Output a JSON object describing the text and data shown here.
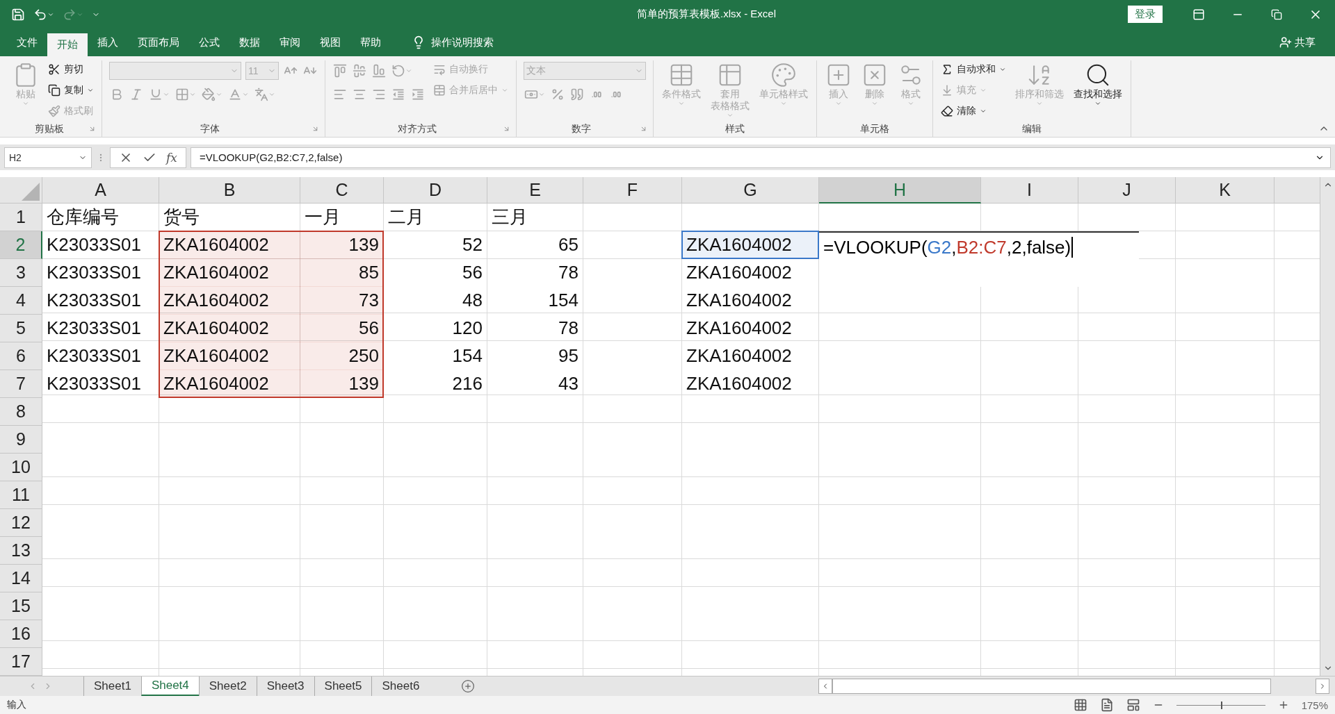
{
  "window": {
    "title": "简单的预算表模板.xlsx  -  Excel",
    "sign_in": "登录"
  },
  "menu_tabs": [
    {
      "label": "文件",
      "selected": false
    },
    {
      "label": "开始",
      "selected": true
    },
    {
      "label": "插入",
      "selected": false
    },
    {
      "label": "页面布局",
      "selected": false
    },
    {
      "label": "公式",
      "selected": false
    },
    {
      "label": "数据",
      "selected": false
    },
    {
      "label": "审阅",
      "selected": false
    },
    {
      "label": "视图",
      "selected": false
    },
    {
      "label": "帮助",
      "selected": false
    }
  ],
  "tell_me": "操作说明搜索",
  "share": "共享",
  "ribbon": [
    {
      "label": "剪贴板",
      "launcher": true,
      "controls": [
        {
          "kind": "large",
          "label": "粘贴",
          "disabled": true,
          "dropdown": true
        },
        {
          "kind": "column",
          "children": [
            {
              "kind": "small",
              "label": "剪切",
              "disabled": false,
              "dropdown": false
            },
            {
              "kind": "small",
              "label": "复制",
              "disabled": false,
              "dropdown": true
            },
            {
              "kind": "small",
              "label": "格式刷",
              "disabled": true,
              "dropdown": false
            }
          ]
        }
      ]
    },
    {
      "label": "字体",
      "launcher": true,
      "controls": [
        {
          "kind": "column",
          "children": [
            {
              "kind": "row",
              "children": [
                {
                  "kind": "combo",
                  "disabled": true
                },
                {
                  "kind": "combo",
                  "value": "11",
                  "disabled": true
                },
                {
                  "kind": "icon",
                  "disabled": true,
                  "dropdown": false
                },
                {
                  "kind": "icon",
                  "disabled": true,
                  "dropdown": false
                }
              ]
            },
            {
              "kind": "row",
              "children": [
                {
                  "kind": "icon",
                  "disabled": true,
                  "dropdown": false
                },
                {
                  "kind": "icon",
                  "disabled": true,
                  "dropdown": false
                },
                {
                  "kind": "icon",
                  "disabled": true,
                  "dropdown": true
                },
                {
                  "kind": "icon",
                  "disabled": true,
                  "dropdown": true
                },
                {
                  "kind": "icon",
                  "disabled": true,
                  "dropdown": true
                },
                {
                  "kind": "icon",
                  "disabled": true,
                  "dropdown": true
                },
                {
                  "kind": "icon",
                  "disabled": true,
                  "dropdown": true
                }
              ]
            }
          ]
        }
      ]
    },
    {
      "label": "对齐方式",
      "launcher": true,
      "controls": [
        {
          "kind": "column",
          "children": [
            {
              "kind": "row",
              "children": [
                {
                  "kind": "icon",
                  "disabled": true,
                  "dropdown": false
                },
                {
                  "kind": "icon",
                  "disabled": true,
                  "dropdown": false
                },
                {
                  "kind": "icon",
                  "disabled": true,
                  "dropdown": false
                },
                {
                  "kind": "icon",
                  "disabled": true,
                  "dropdown": true
                }
              ]
            },
            {
              "kind": "row",
              "children": [
                {
                  "kind": "icon",
                  "disabled": true,
                  "dropdown": false
                },
                {
                  "kind": "icon",
                  "disabled": true,
                  "dropdown": false
                },
                {
                  "kind": "icon",
                  "disabled": true,
                  "dropdown": false
                },
                {
                  "kind": "icon",
                  "disabled": true,
                  "dropdown": false
                },
                {
                  "kind": "icon",
                  "disabled": true,
                  "dropdown": false
                }
              ]
            }
          ]
        },
        {
          "kind": "column",
          "children": [
            {
              "kind": "small",
              "label": "自动换行",
              "disabled": true,
              "dropdown": false
            },
            {
              "kind": "small",
              "label": "合并后居中",
              "disabled": true,
              "dropdown": true
            }
          ]
        }
      ]
    },
    {
      "label": "数字",
      "launcher": true,
      "controls": [
        {
          "kind": "column",
          "children": [
            {
              "kind": "combo",
              "value": "文本",
              "disabled": true
            },
            {
              "kind": "row",
              "children": [
                {
                  "kind": "icon",
                  "disabled": true,
                  "dropdown": true
                },
                {
                  "kind": "icon",
                  "disabled": true,
                  "dropdown": false
                },
                {
                  "kind": "icon",
                  "disabled": true,
                  "dropdown": false
                },
                {
                  "kind": "icon",
                  "disabled": true,
                  "dropdown": false
                },
                {
                  "kind": "icon",
                  "disabled": true,
                  "dropdown": false
                }
              ]
            }
          ]
        }
      ]
    },
    {
      "label": "样式",
      "launcher": false,
      "controls": [
        {
          "kind": "large",
          "label": "条件格式",
          "disabled": true,
          "dropdown": true
        },
        {
          "kind": "large",
          "lines": [
            "套用",
            "表格格式"
          ],
          "disabled": true,
          "dropdown": true
        },
        {
          "kind": "large",
          "label": "单元格样式",
          "disabled": true,
          "dropdown": true
        }
      ]
    },
    {
      "label": "单元格",
      "launcher": false,
      "controls": [
        {
          "kind": "large",
          "label": "插入",
          "disabled": true,
          "dropdown": true
        },
        {
          "kind": "large",
          "label": "删除",
          "disabled": true,
          "dropdown": true
        },
        {
          "kind": "large",
          "label": "格式",
          "disabled": true,
          "dropdown": true
        }
      ]
    },
    {
      "label": "编辑",
      "launcher": false,
      "controls": [
        {
          "kind": "column",
          "children": [
            {
              "kind": "small",
              "label": "自动求和",
              "disabled": false,
              "dropdown": true
            },
            {
              "kind": "small",
              "label": "填充",
              "disabled": true,
              "dropdown": true
            },
            {
              "kind": "small",
              "label": "清除",
              "disabled": false,
              "dropdown": true
            }
          ]
        },
        {
          "kind": "large",
          "label": "排序和筛选",
          "disabled": true,
          "dropdown": true
        },
        {
          "kind": "large",
          "label": "查找和选择",
          "disabled": false,
          "dropdown": true
        }
      ]
    }
  ],
  "formula_bar": {
    "name_box": "H2",
    "fx": "fx",
    "formula": "=VLOOKUP(G2,B2:C7,2,false)"
  },
  "columns": [
    {
      "label": "A",
      "selected": false
    },
    {
      "label": "B",
      "selected": false
    },
    {
      "label": "C",
      "selected": false
    },
    {
      "label": "D",
      "selected": false
    },
    {
      "label": "E",
      "selected": false
    },
    {
      "label": "F",
      "selected": false
    },
    {
      "label": "G",
      "selected": false
    },
    {
      "label": "H",
      "selected": true
    },
    {
      "label": "I",
      "selected": false
    },
    {
      "label": "J",
      "selected": false
    },
    {
      "label": "K",
      "selected": false
    }
  ],
  "rows": [
    {
      "number": "1",
      "selected": false,
      "cells": [
        {
          "kind": "text",
          "text": "仓库编号"
        },
        {
          "kind": "text",
          "text": "货号"
        },
        {
          "kind": "text",
          "text": "一月"
        },
        {
          "kind": "text",
          "text": "二月"
        },
        {
          "kind": "text",
          "text": "三月"
        }
      ]
    },
    {
      "number": "2",
      "selected": true,
      "cells": [
        {
          "kind": "text",
          "text": "K23033S01"
        },
        {
          "kind": "text",
          "text": "ZKA1604002",
          "color": "#c0392b"
        },
        {
          "kind": "number",
          "text": "139",
          "color": "#c0392b"
        },
        {
          "kind": "number",
          "text": "52"
        },
        {
          "kind": "number",
          "text": "65"
        },
        {
          "kind": "empty"
        },
        {
          "kind": "text",
          "text": "ZKA1604002",
          "color": "#3a78c9"
        },
        {
          "kind": "formula",
          "segments": [
            {
              "text": "=VLOOKUP(",
              "color": "#000000"
            },
            {
              "text": "G2",
              "color": "#3a78c9"
            },
            {
              "text": ",",
              "color": "#000000"
            },
            {
              "text": "B2:C7",
              "color": "#c0392b"
            },
            {
              "text": ",2,false)",
              "color": "#000000"
            }
          ]
        }
      ]
    },
    {
      "number": "3",
      "selected": false,
      "cells": [
        {
          "kind": "text",
          "text": "K23033S01"
        },
        {
          "kind": "text",
          "text": "ZKA1604002",
          "color": "#c0392b"
        },
        {
          "kind": "number",
          "text": "85",
          "color": "#c0392b"
        },
        {
          "kind": "number",
          "text": "56"
        },
        {
          "kind": "number",
          "text": "78"
        },
        {
          "kind": "empty"
        },
        {
          "kind": "text",
          "text": "ZKA1604002"
        }
      ]
    },
    {
      "number": "4",
      "selected": false,
      "cells": [
        {
          "kind": "text",
          "text": "K23033S01"
        },
        {
          "kind": "text",
          "text": "ZKA1604002",
          "color": "#c0392b"
        },
        {
          "kind": "number",
          "text": "73",
          "color": "#c0392b"
        },
        {
          "kind": "number",
          "text": "48"
        },
        {
          "kind": "number",
          "text": "154"
        },
        {
          "kind": "empty"
        },
        {
          "kind": "text",
          "text": "ZKA1604002"
        }
      ]
    },
    {
      "number": "5",
      "selected": false,
      "cells": [
        {
          "kind": "text",
          "text": "K23033S01"
        },
        {
          "kind": "text",
          "text": "ZKA1604002",
          "color": "#c0392b"
        },
        {
          "kind": "number",
          "text": "56",
          "color": "#c0392b"
        },
        {
          "kind": "number",
          "text": "120"
        },
        {
          "kind": "number",
          "text": "78"
        },
        {
          "kind": "empty"
        },
        {
          "kind": "text",
          "text": "ZKA1604002"
        }
      ]
    },
    {
      "number": "6",
      "selected": false,
      "cells": [
        {
          "kind": "text",
          "text": "K23033S01"
        },
        {
          "kind": "text",
          "text": "ZKA1604002",
          "color": "#c0392b"
        },
        {
          "kind": "number",
          "text": "250",
          "color": "#c0392b"
        },
        {
          "kind": "number",
          "text": "154"
        },
        {
          "kind": "number",
          "text": "95"
        },
        {
          "kind": "empty"
        },
        {
          "kind": "text",
          "text": "ZKA1604002"
        }
      ]
    },
    {
      "number": "7",
      "selected": false,
      "cells": [
        {
          "kind": "text",
          "text": "K23033S01"
        },
        {
          "kind": "text",
          "text": "ZKA1604002",
          "color": "#c0392b"
        },
        {
          "kind": "number",
          "text": "139",
          "color": "#c0392b"
        },
        {
          "kind": "number",
          "text": "216"
        },
        {
          "kind": "number",
          "text": "43"
        },
        {
          "kind": "empty"
        },
        {
          "kind": "text",
          "text": "ZKA1604002"
        }
      ]
    },
    {
      "number": "8",
      "selected": false
    },
    {
      "number": "9",
      "selected": false
    },
    {
      "number": "10",
      "selected": false
    },
    {
      "number": "11",
      "selected": false
    },
    {
      "number": "12",
      "selected": false
    },
    {
      "number": "13",
      "selected": false
    },
    {
      "number": "14",
      "selected": false
    },
    {
      "number": "15",
      "selected": false
    },
    {
      "number": "16",
      "selected": false
    },
    {
      "number": "17",
      "selected": false
    }
  ],
  "sheet_tabs": [
    {
      "label": "Sheet1",
      "selected": false
    },
    {
      "label": "Sheet4",
      "selected": true
    },
    {
      "label": "Sheet2",
      "selected": false
    },
    {
      "label": "Sheet3",
      "selected": false
    },
    {
      "label": "Sheet5",
      "selected": false
    },
    {
      "label": "Sheet6",
      "selected": false
    }
  ],
  "status_bar": {
    "mode": "输入",
    "zoom": {
      "level": 0.5,
      "reading": "175%"
    }
  }
}
